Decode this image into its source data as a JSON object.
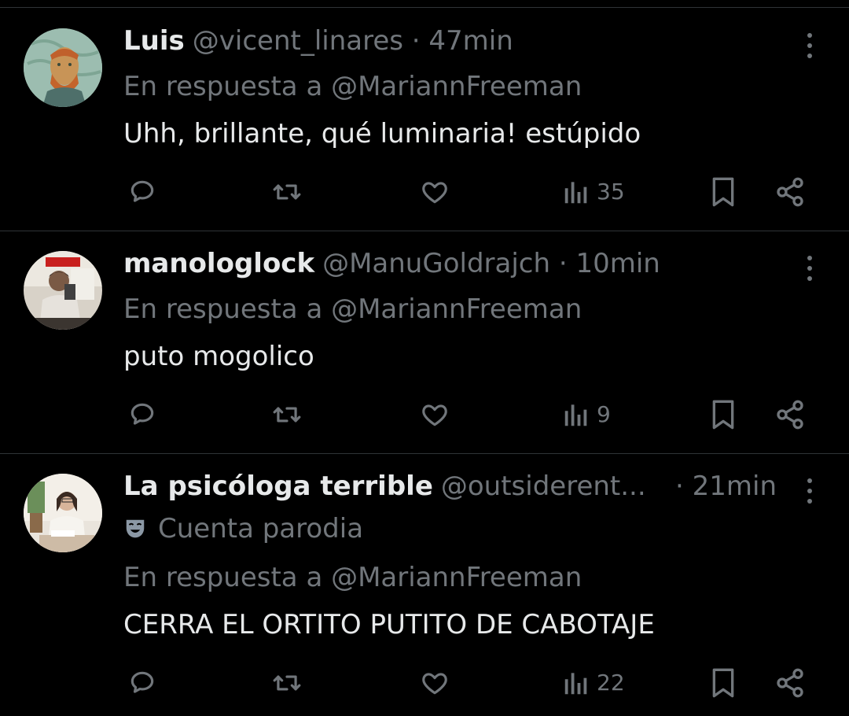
{
  "colors": {
    "background": "#000000",
    "text_primary": "#e7e9ea",
    "text_secondary": "#71767b",
    "divider": "#2f3336"
  },
  "tweets": [
    {
      "name": "Luis",
      "handle": "@vicent_linares",
      "separator": "·",
      "time": "47min",
      "reply_to": "En respuesta a @MariannFreeman",
      "text": "Uhh, brillante, qué luminaria! estúpido",
      "views": "35",
      "avatar": "avatar-van-gogh"
    },
    {
      "name": "manologlock",
      "handle": "@ManuGoldrajch",
      "separator": "·",
      "time": "10min",
      "reply_to": "En respuesta a @MariannFreeman",
      "text": "puto mogolico",
      "views": "9",
      "avatar": "avatar-photo-man"
    },
    {
      "name": "La psicóloga terrible",
      "handle": "@outsiderent...",
      "separator": "·",
      "time": "21min",
      "parody_label": "Cuenta parodia",
      "parody_icon": "theater-mask-icon",
      "reply_to": "En respuesta a @MariannFreeman",
      "text": "CERRA EL ORTITO PUTITO DE CABOTAJE",
      "views": "22",
      "avatar": "avatar-photo-woman"
    }
  ],
  "icons": {
    "reply": "reply-icon",
    "retweet": "retweet-icon",
    "like": "heart-icon",
    "views": "views-chart-icon",
    "bookmark": "bookmark-icon",
    "share": "share-icon",
    "more": "more-options-icon"
  }
}
